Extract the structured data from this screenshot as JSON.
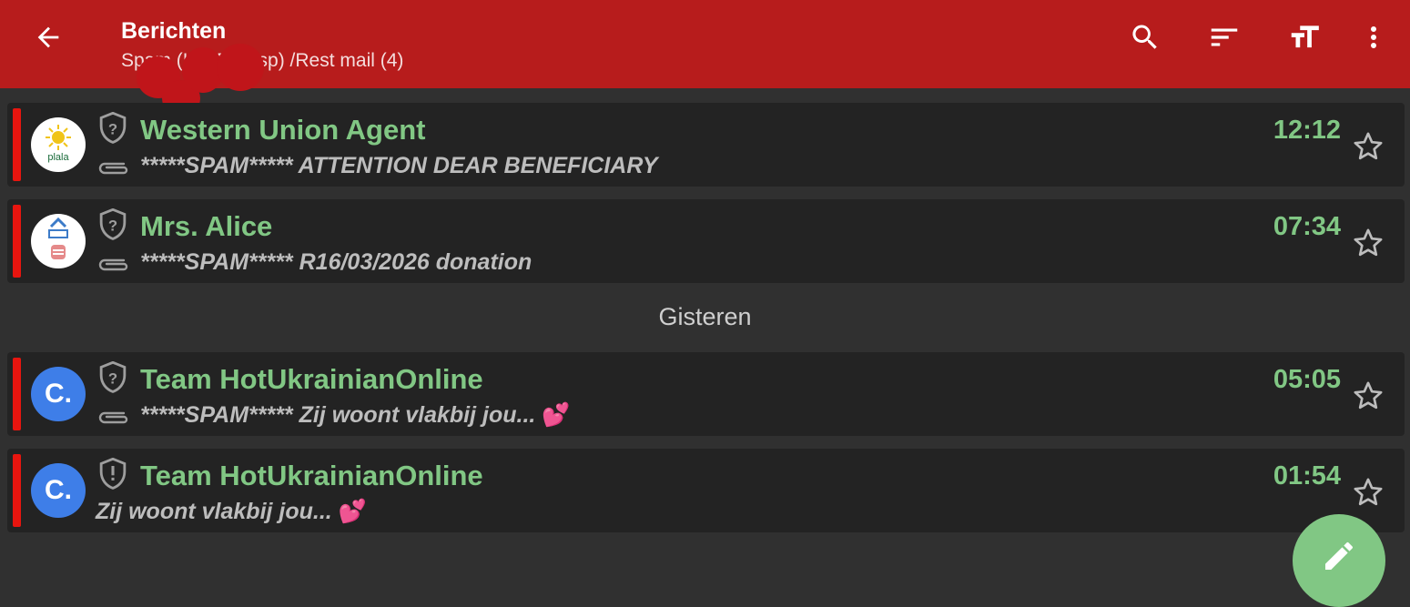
{
  "header": {
    "title": "Berichten",
    "subtitle": "Spam (IMAP/Kasp) /Rest mail (4)",
    "back_icon": "arrow-back-icon",
    "actions": [
      "search-icon",
      "sort-icon",
      "text-size-icon",
      "more-vert-icon"
    ],
    "color": "#b71c1c"
  },
  "messages": [
    {
      "sender": "Western Union Agent",
      "time": "12:12",
      "subject": "*****SPAM***** ATTENTION DEAR BENEFICIARY",
      "avatar_text": "plala",
      "attachment": true,
      "shield": "question"
    },
    {
      "sender": "Mrs. Alice",
      "time": "07:34",
      "subject": "*****SPAM***** R16/03/2026 donation",
      "avatar_text": "",
      "attachment": true,
      "shield": "question"
    },
    {
      "sender": "Team HotUkrainianOnline",
      "time": "05:05",
      "subject": "*****SPAM***** Zij woont vlakbij jou...",
      "emoji": "💕",
      "avatar_text": "C.",
      "attachment": true,
      "shield": "question"
    },
    {
      "sender": "Team HotUkrainianOnline",
      "time": "01:54",
      "subject": "Zij woont vlakbij jou...",
      "emoji": "💕",
      "avatar_text": "C.",
      "attachment": false,
      "shield": "exclamation"
    }
  ],
  "divider_label": "Gisteren",
  "fab_icon": "edit-pencil-icon",
  "colors": {
    "accent_green": "#81c784",
    "flag_red": "#e8150f",
    "avatar_blue": "#3e7ee8"
  }
}
